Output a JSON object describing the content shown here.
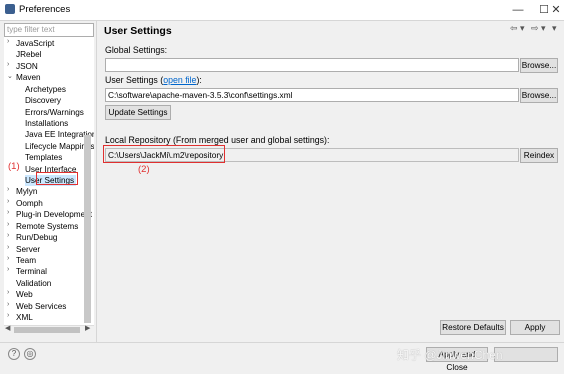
{
  "window": {
    "title": "Preferences"
  },
  "sidebar": {
    "filter_placeholder": "type filter text",
    "items": [
      {
        "label": "JavaScript",
        "arrow": "›"
      },
      {
        "label": "JRebel",
        "arrow": ""
      },
      {
        "label": "JSON",
        "arrow": "›"
      },
      {
        "label": "Maven",
        "arrow": "⌄"
      },
      {
        "label": "Archetypes",
        "arrow": ""
      },
      {
        "label": "Discovery",
        "arrow": ""
      },
      {
        "label": "Errors/Warnings",
        "arrow": ""
      },
      {
        "label": "Installations",
        "arrow": ""
      },
      {
        "label": "Java EE Integration",
        "arrow": ""
      },
      {
        "label": "Lifecycle Mappings",
        "arrow": ""
      },
      {
        "label": "Templates",
        "arrow": ""
      },
      {
        "label": "User Interface",
        "arrow": ""
      },
      {
        "label": "User Settings",
        "arrow": ""
      },
      {
        "label": "Mylyn",
        "arrow": "›"
      },
      {
        "label": "Oomph",
        "arrow": "›"
      },
      {
        "label": "Plug-in Development",
        "arrow": "›"
      },
      {
        "label": "Remote Systems",
        "arrow": "›"
      },
      {
        "label": "Run/Debug",
        "arrow": "›"
      },
      {
        "label": "Server",
        "arrow": "›"
      },
      {
        "label": "Team",
        "arrow": "›"
      },
      {
        "label": "Terminal",
        "arrow": "›"
      },
      {
        "label": "Validation",
        "arrow": ""
      },
      {
        "label": "Web",
        "arrow": "›"
      },
      {
        "label": "Web Services",
        "arrow": "›"
      },
      {
        "label": "XML",
        "arrow": "›"
      }
    ],
    "selected": "User Settings"
  },
  "annotations": {
    "one": "(1)",
    "two": "(2)"
  },
  "main": {
    "title": "User Settings",
    "global_settings_label": "Global Settings:",
    "global_settings_value": "",
    "browse_label": "Browse...",
    "user_settings_label": "User Settings (",
    "open_file_link": "open file",
    "user_settings_label_end": "):",
    "user_settings_value": "C:\\software\\apache-maven-3.5.3\\conf\\settings.xml",
    "update_settings_label": "Update Settings",
    "local_repo_label": "Local Repository (From merged user and global settings):",
    "local_repo_value": "C:\\Users\\JackMi\\.m2\\repository",
    "reindex_label": "Reindex",
    "restore_defaults_label": "Restore Defaults",
    "apply_label": "Apply"
  },
  "footer": {
    "apply_close_label": "Apply and Close",
    "watermark": "知乎 @JinwenChen"
  },
  "icons": {
    "help": "?",
    "import": "◎",
    "minimize": "—",
    "maximize": "☐",
    "close": "✕",
    "back": "⇦ ▾",
    "forward": "⇨ ▾",
    "menu": "▾"
  },
  "colors": {
    "annotation": "#e03030",
    "link": "#0066cc",
    "selection": "#cce8ff"
  }
}
